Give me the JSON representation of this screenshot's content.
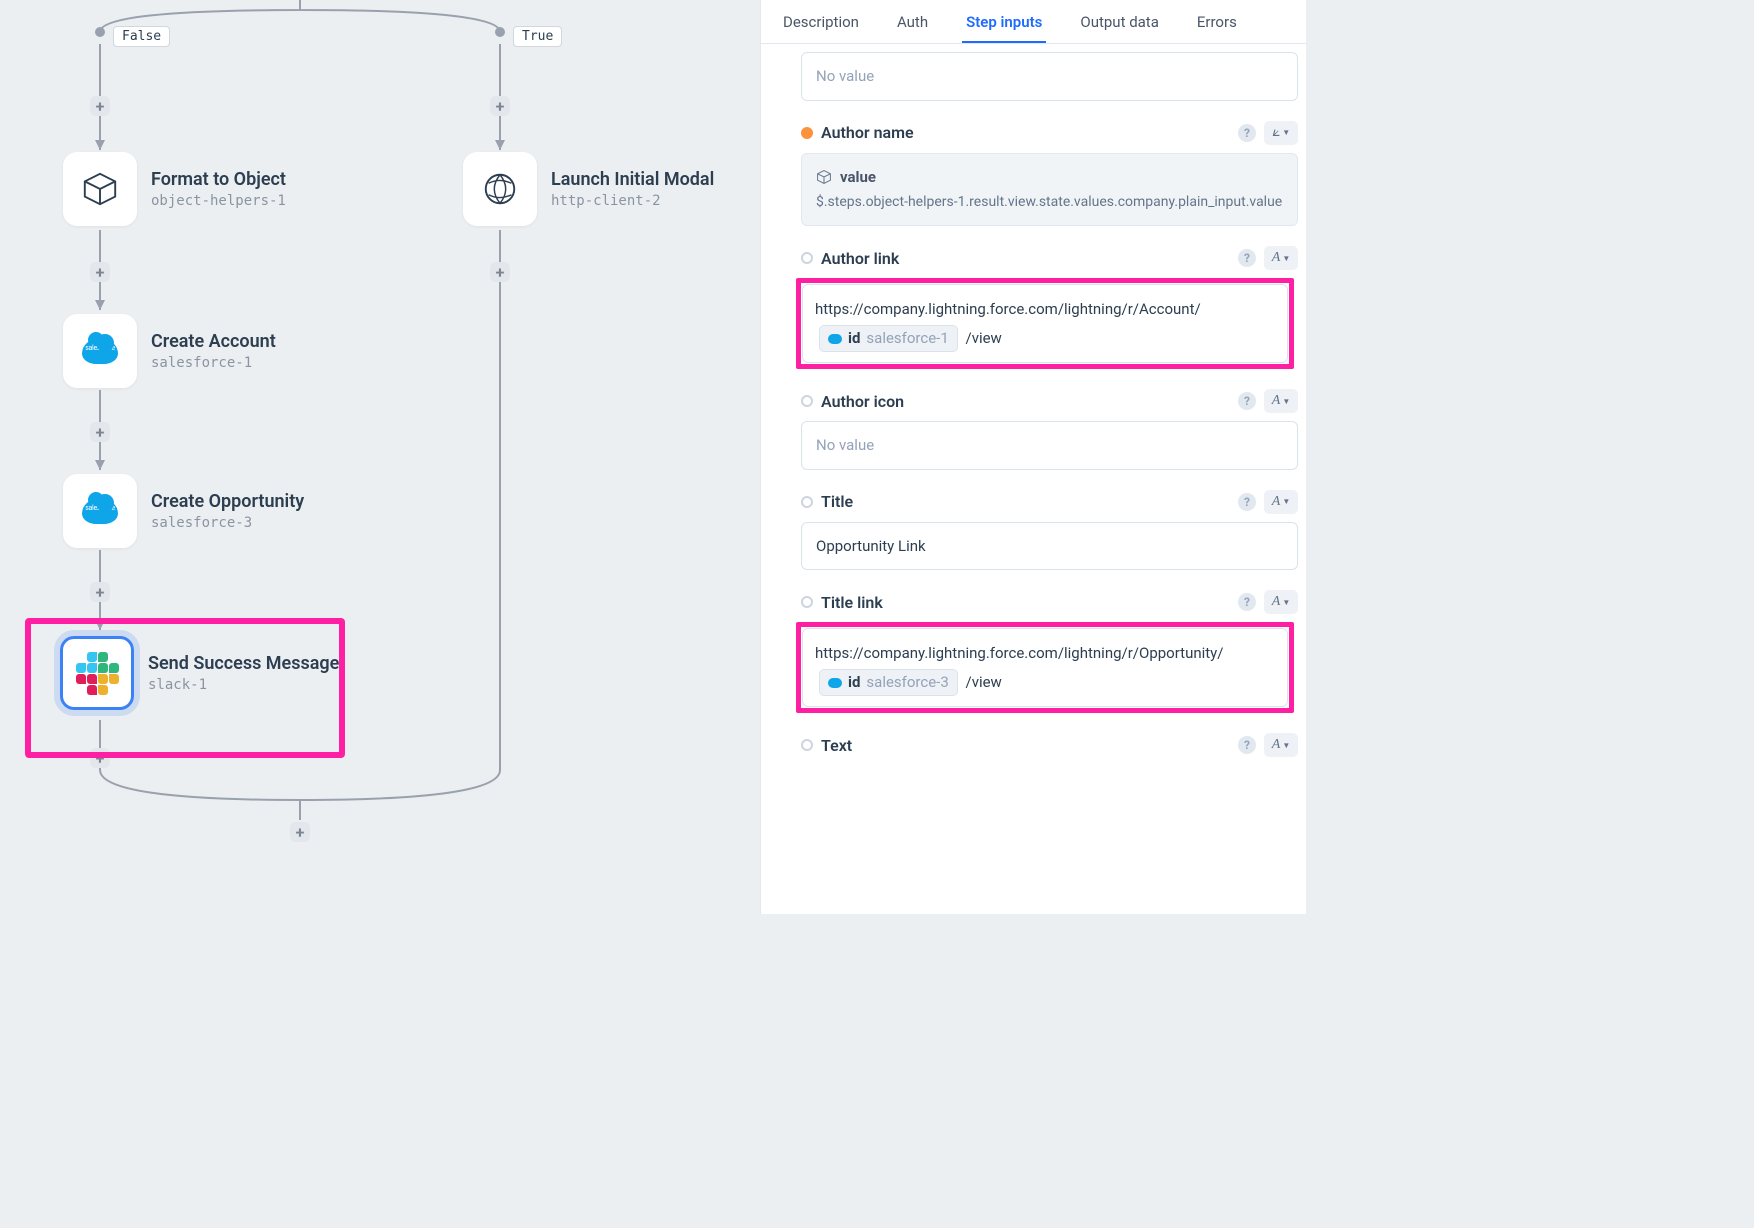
{
  "canvas": {
    "branches": {
      "false": "False",
      "true": "True"
    },
    "nodes": {
      "format": {
        "title": "Format to Object",
        "sub": "object-helpers-1"
      },
      "modal": {
        "title": "Launch Initial Modal",
        "sub": "http-client-2"
      },
      "account": {
        "title": "Create Account",
        "sub": "salesforce-1"
      },
      "opp": {
        "title": "Create Opportunity",
        "sub": "salesforce-3"
      },
      "slack": {
        "title": "Send Success Message",
        "sub": "slack-1"
      }
    }
  },
  "tabs": {
    "description": "Description",
    "auth": "Auth",
    "step_inputs": "Step inputs",
    "output_data": "Output data",
    "errors": "Errors"
  },
  "fields": {
    "no_value": "No value",
    "author_name": {
      "label": "Author name",
      "box_title": "value",
      "path": "$.steps.object-helpers-1.result.view.state.values.company.plain_input.value"
    },
    "author_link": {
      "label": "Author link",
      "url_before": "https://company.lightning.force.com/lightning/r/Account/",
      "pill_key": "id",
      "pill_src": "salesforce-1",
      "url_after": "/view"
    },
    "author_icon": {
      "label": "Author icon"
    },
    "title": {
      "label": "Title",
      "value": "Opportunity Link"
    },
    "title_link": {
      "label": "Title link",
      "url_before": "https://company.lightning.force.com/lightning/r/Opportunity/",
      "pill_key": "id",
      "pill_src": "salesforce-3",
      "url_after": "/view"
    },
    "text": {
      "label": "Text"
    }
  },
  "type_chip": {
    "letter": "A",
    "caret": "▼"
  },
  "type_chip_branch": "⟀"
}
